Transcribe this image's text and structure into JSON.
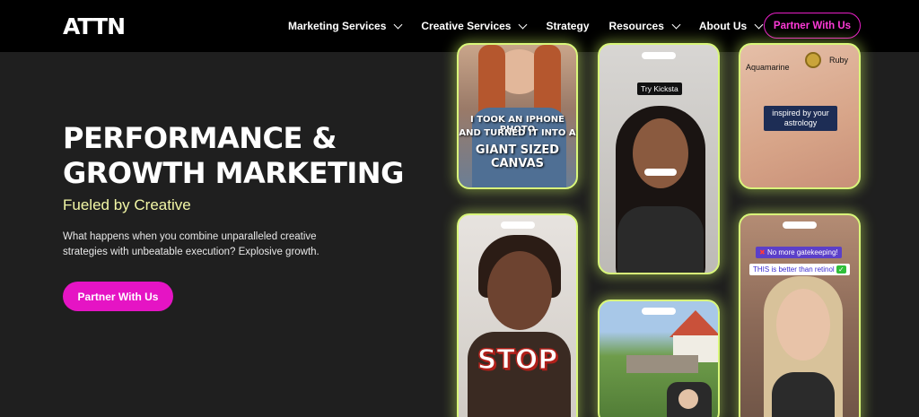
{
  "logo": "ATTN",
  "nav": {
    "items": [
      {
        "label": "Marketing Services",
        "has_dropdown": true
      },
      {
        "label": "Creative Services",
        "has_dropdown": true
      },
      {
        "label": "Strategy",
        "has_dropdown": false
      },
      {
        "label": "Resources",
        "has_dropdown": true
      },
      {
        "label": "About Us",
        "has_dropdown": true
      }
    ],
    "cta": "Partner With Us"
  },
  "hero": {
    "title_line1": "PERFORMANCE &",
    "title_line2": "GROWTH MARKETING",
    "subtitle": "Fueled by Creative",
    "description": "What happens when you combine unparalleled creative strategies with unbeatable execution? Explosive growth.",
    "cta": "Partner With Us"
  },
  "cards": {
    "card1_caption_line1": "I TOOK AN IPHONE PHOTO",
    "card1_caption_line2": "AND TURNED IT INTO A",
    "card1_caption_line3": "GIANT SIZED CANVAS",
    "card2_tag": "Try Kicksta",
    "card3_label_left": "Aquamarine",
    "card3_label_right": "Ruby",
    "card3_caption": "inspired by your astrology",
    "card4_caption": "STOP",
    "card6_tag1": "No more gatekeeping!",
    "card6_tag2": "THIS is better than retinol"
  },
  "colors": {
    "accent": "#e514c4",
    "subtitle": "#f3f7a6",
    "card_glow": "#d9f77a",
    "nav_bg": "#000000",
    "page_bg": "#1f1f1f"
  }
}
